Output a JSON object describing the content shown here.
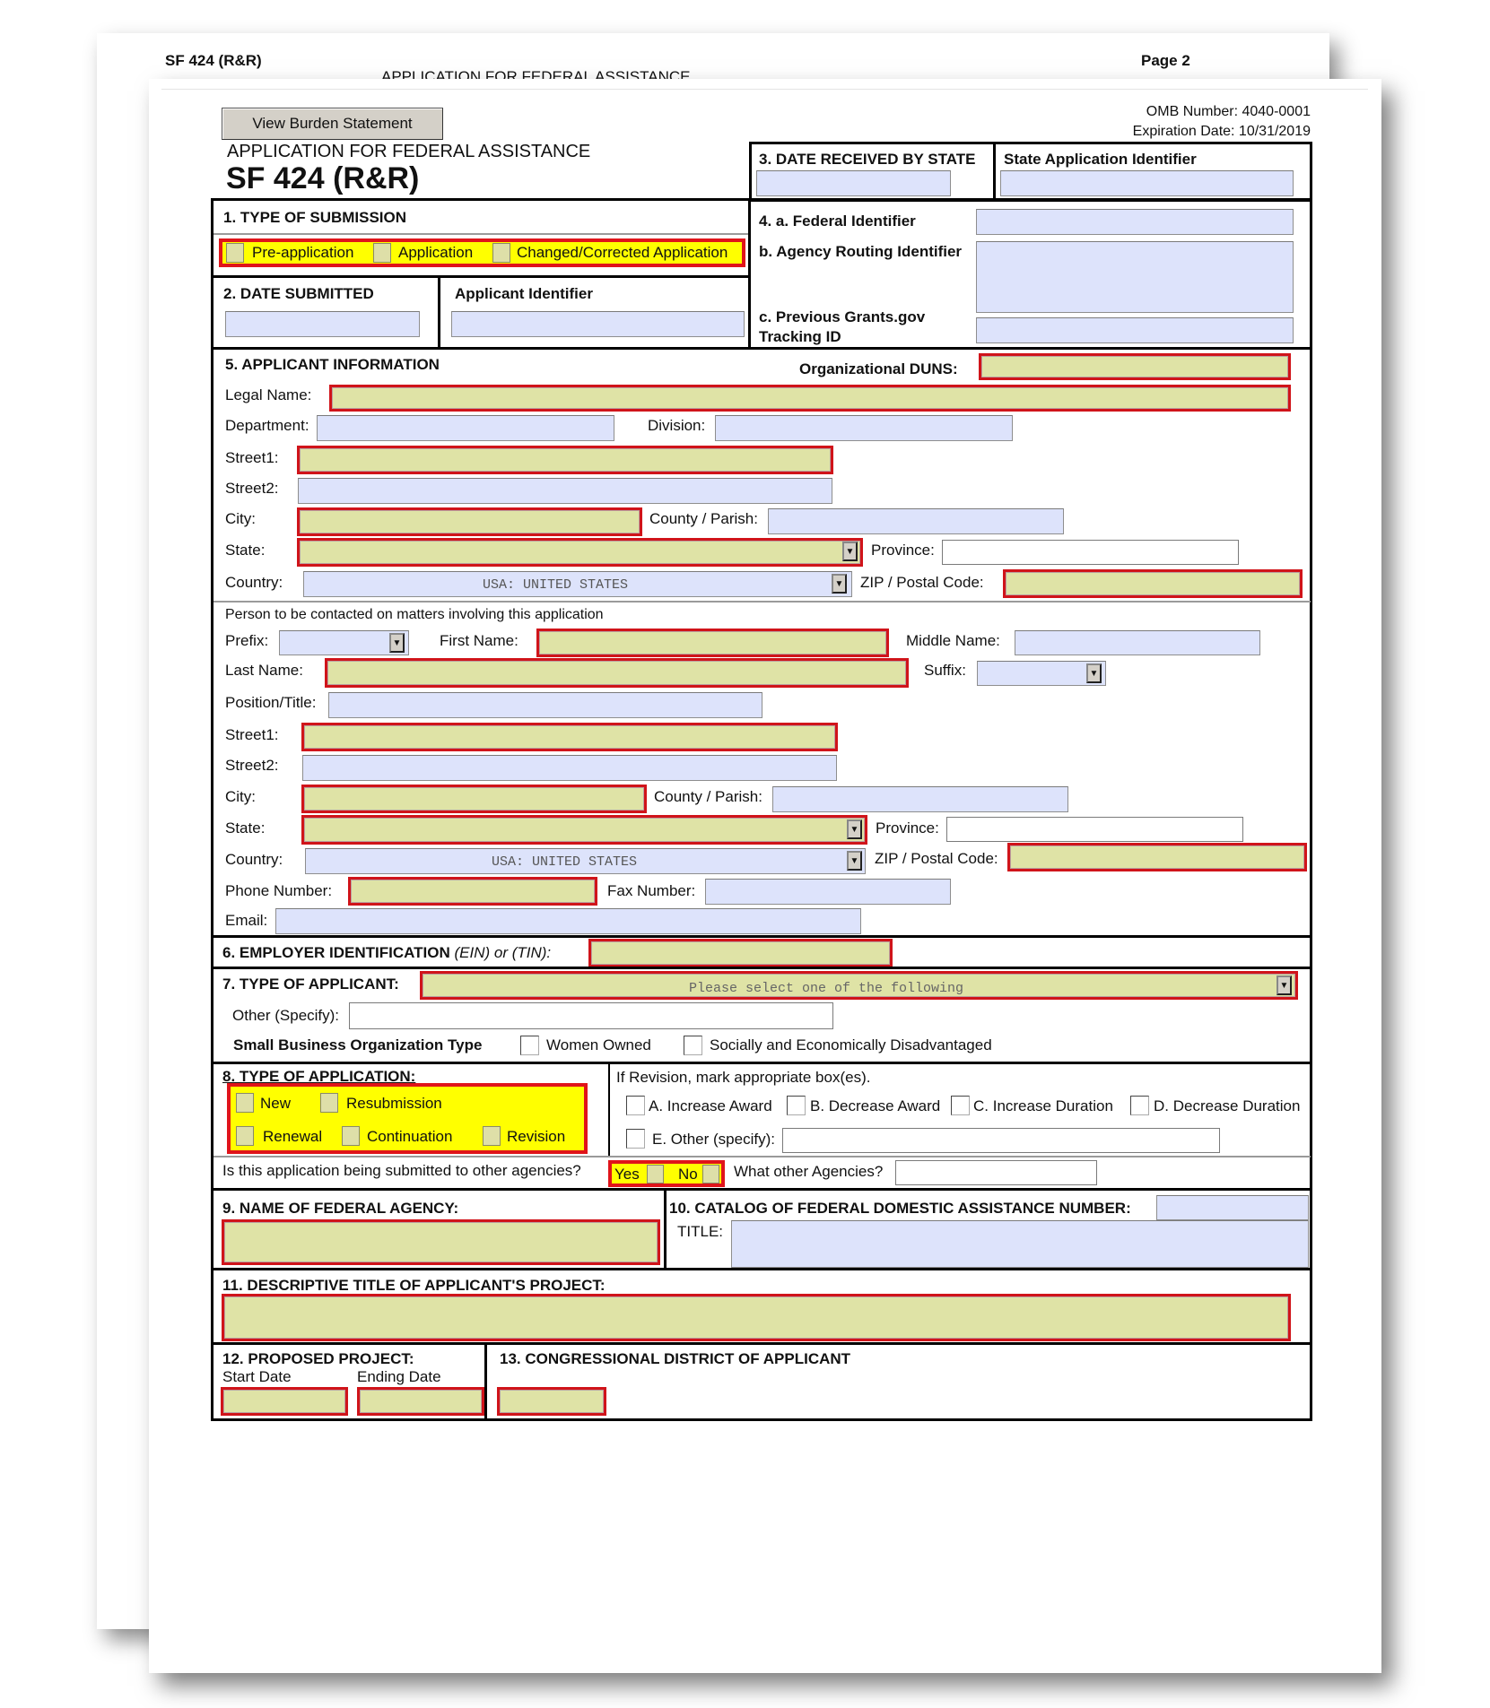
{
  "back_page": {
    "form_title": "SF 424 (R&R)",
    "subtitle": "APPLICATION FOR FEDERAL ASSISTANCE",
    "page_label": "Page 2"
  },
  "header": {
    "burden_button": "View Burden Statement",
    "app_title": "APPLICATION FOR FEDERAL ASSISTANCE",
    "form_name": "SF 424 (R&R)",
    "omb_number": "OMB Number: 4040-0001",
    "expiration": "Expiration Date: 10/31/2019"
  },
  "colors": {
    "required_fill": "#dfe3a6",
    "required_border": "#d0141a",
    "optional_fill": "#dde3fb",
    "group_highlight": "#ffff00"
  },
  "section1": {
    "label": "1. TYPE OF SUBMISSION",
    "options": [
      "Pre-application",
      "Application",
      "Changed/Corrected Application"
    ]
  },
  "section2": {
    "date_submitted_label": "2. DATE SUBMITTED",
    "applicant_identifier_label": "Applicant Identifier"
  },
  "section3": {
    "date_received_label": "3. DATE RECEIVED BY STATE",
    "state_app_id_label": "State Application Identifier"
  },
  "section4": {
    "federal_identifier_label": "4. a. Federal Identifier",
    "agency_routing_label": "b. Agency Routing Identifier",
    "prev_tracking_label_line1": "c. Previous Grants.gov",
    "prev_tracking_label_line2": "Tracking ID"
  },
  "section5": {
    "label": "5. APPLICANT INFORMATION",
    "duns_label": "Organizational DUNS:",
    "legal_name_label": "Legal Name:",
    "department_label": "Department:",
    "division_label": "Division:",
    "street1_label": "Street1:",
    "street2_label": "Street2:",
    "city_label": "City:",
    "county_label": "County / Parish:",
    "state_label": "State:",
    "province_label": "Province:",
    "country_label": "Country:",
    "country_value": "USA: UNITED STATES",
    "zip_label": "ZIP / Postal Code:",
    "contact": {
      "heading": "Person to be contacted on matters involving this application",
      "prefix_label": "Prefix:",
      "first_name_label": "First Name:",
      "middle_name_label": "Middle Name:",
      "last_name_label": "Last Name:",
      "suffix_label": "Suffix:",
      "position_label": "Position/Title:",
      "street1_label": "Street1:",
      "street2_label": "Street2:",
      "city_label": "City:",
      "county_label": "County / Parish:",
      "state_label": "State:",
      "province_label": "Province:",
      "country_label": "Country:",
      "country_value": "USA: UNITED STATES",
      "zip_label": "ZIP / Postal Code:",
      "phone_label": "Phone Number:",
      "fax_label": "Fax Number:",
      "email_label": "Email:"
    }
  },
  "section6": {
    "label": "6. EMPLOYER IDENTIFICATION",
    "label_italic": "(EIN) or (TIN):"
  },
  "section7": {
    "label": "7. TYPE OF APPLICANT:",
    "select_placeholder": "Please select one of the following",
    "other_label": "Other (Specify):",
    "small_business_label": "Small Business Organization Type",
    "women_owned": "Women Owned",
    "disadvantaged": "Socially and Economically Disadvantaged"
  },
  "section8": {
    "label": "8. TYPE OF APPLICATION:",
    "options": [
      "New",
      "Resubmission",
      "Renewal",
      "Continuation",
      "Revision"
    ],
    "revision_heading": "If Revision, mark appropriate box(es).",
    "revision_options": [
      "A. Increase Award",
      "B. Decrease Award",
      "C. Increase Duration",
      "D. Decrease Duration",
      "E. Other (specify):"
    ],
    "other_agencies_question": "Is this application being submitted to other agencies?",
    "yes_label": "Yes",
    "no_label": "No",
    "what_agencies_label": "What other Agencies?"
  },
  "section9": {
    "label": "9. NAME OF FEDERAL AGENCY:"
  },
  "section10": {
    "label": "10. CATALOG OF FEDERAL DOMESTIC ASSISTANCE NUMBER:",
    "title_label": "TITLE:"
  },
  "section11": {
    "label": "11. DESCRIPTIVE TITLE OF APPLICANT'S PROJECT:"
  },
  "section12": {
    "label": "12. PROPOSED PROJECT:",
    "start_label": "Start Date",
    "end_label": "Ending Date"
  },
  "section13": {
    "label": "13. CONGRESSIONAL DISTRICT OF APPLICANT"
  }
}
